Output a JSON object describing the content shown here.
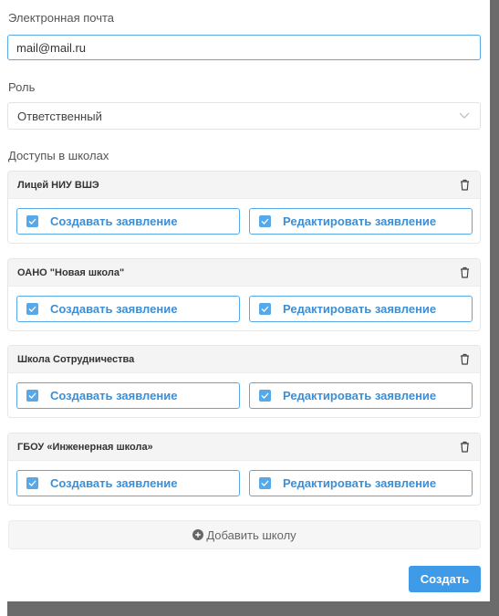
{
  "form": {
    "email_label": "Электронная почта",
    "email_value": "mail@mail.ru",
    "role_label": "Роль",
    "role_value": "Ответственный",
    "access_label": "Доступы в школах"
  },
  "schools": [
    {
      "name": "Лицей НИУ ВШЭ",
      "perm_create": "Создавать заявление",
      "perm_edit": "Редактировать заявление"
    },
    {
      "name": "ОАНО \"Новая школа\"",
      "perm_create": "Создавать заявление",
      "perm_edit": "Редактировать заявление"
    },
    {
      "name": "Школа Сотрудничества",
      "perm_create": "Создавать заявление",
      "perm_edit": "Редактировать заявление"
    },
    {
      "name": "ГБОУ «Инженерная школа»",
      "perm_create": "Создавать заявление",
      "perm_edit": "Редактировать заявление"
    }
  ],
  "actions": {
    "add_school": "Добавить школу",
    "create": "Создать"
  },
  "icons": {
    "role_chevron": "chevron-down-icon",
    "delete": "trash-icon",
    "checkbox": "checkbox-checked-icon",
    "add": "plus-circle-icon"
  },
  "colors": {
    "accent": "#3f9ae8",
    "checkbox": "#56a8e8",
    "perm_text": "#3c8fd6"
  }
}
